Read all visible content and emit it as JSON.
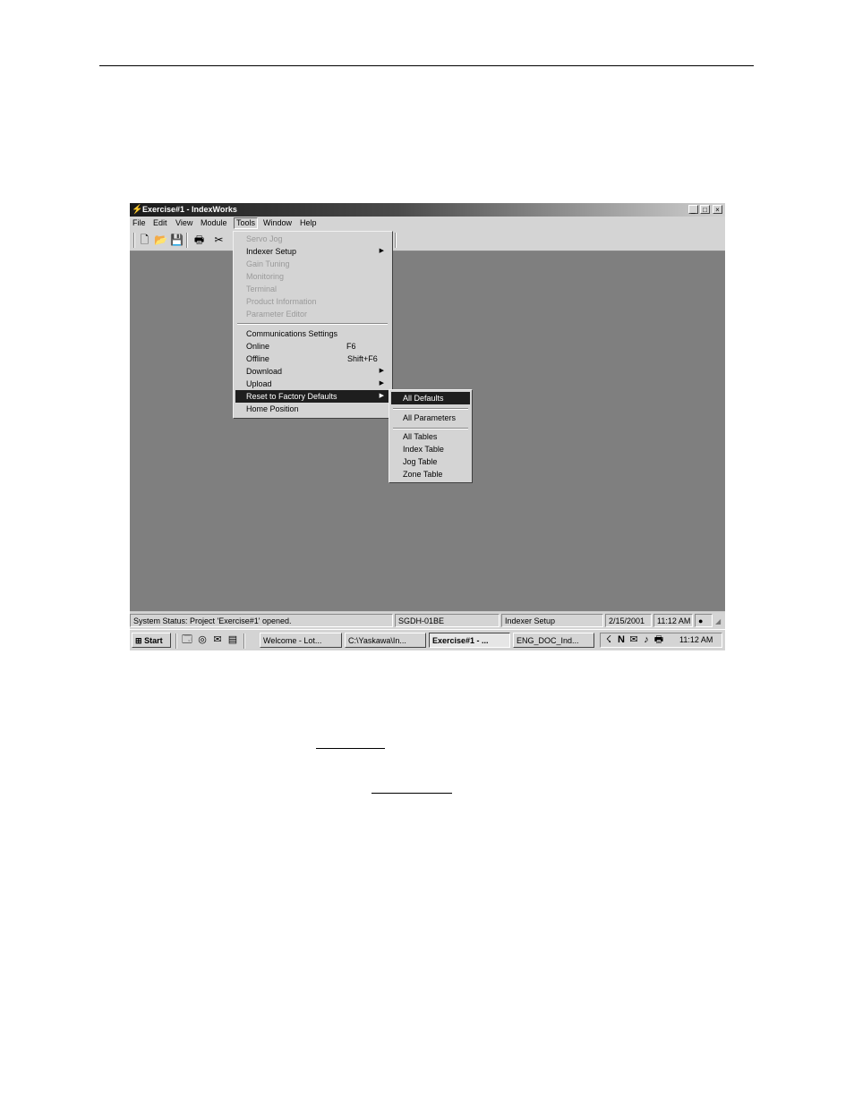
{
  "window": {
    "title": "Exercise#1 - IndexWorks",
    "controls": {
      "minimize": "_",
      "maximize": "□",
      "close": "×"
    }
  },
  "menubar": [
    "File",
    "Edit",
    "View",
    "Module",
    "Tools",
    "Window",
    "Help"
  ],
  "tools_menu": {
    "items": [
      {
        "label": "Servo Jog",
        "enabled": false
      },
      {
        "label": "Indexer Setup",
        "enabled": true,
        "submenu": true
      },
      {
        "label": "Gain Tuning",
        "enabled": false
      },
      {
        "label": "Monitoring",
        "enabled": false
      },
      {
        "label": "Terminal",
        "enabled": false
      },
      {
        "label": "Product Information",
        "enabled": false
      },
      {
        "label": "Parameter Editor",
        "enabled": false
      },
      {
        "label": "Communications Settings",
        "enabled": true
      },
      {
        "label": "Online",
        "shortcut": "F6",
        "enabled": true
      },
      {
        "label": "Offline",
        "shortcut": "Shift+F6",
        "enabled": true
      },
      {
        "label": "Download",
        "enabled": true,
        "submenu": true
      },
      {
        "label": "Upload",
        "enabled": true,
        "submenu": true
      },
      {
        "label": "Reset to Factory Defaults",
        "enabled": true,
        "submenu": true,
        "highlighted": true
      },
      {
        "label": "Home Position",
        "enabled": true
      }
    ]
  },
  "reset_submenu": {
    "items": [
      "All Defaults",
      "All Parameters",
      "All Tables",
      "Index Table",
      "Jog Table",
      "Zone Table"
    ]
  },
  "statusbar": {
    "message": "System Status: Project 'Exercise#1' opened.",
    "drive": "SGDH-01BE",
    "mode": "Indexer Setup",
    "date": "2/15/2001",
    "time": "11:12 AM"
  },
  "taskbar": {
    "start": "Start",
    "buttons": [
      "Welcome - Lot...",
      "C:\\Yaskawa\\In...",
      "Exercise#1 - ...",
      "ENG_DOC_Ind..."
    ],
    "clock": "11:12 AM"
  }
}
